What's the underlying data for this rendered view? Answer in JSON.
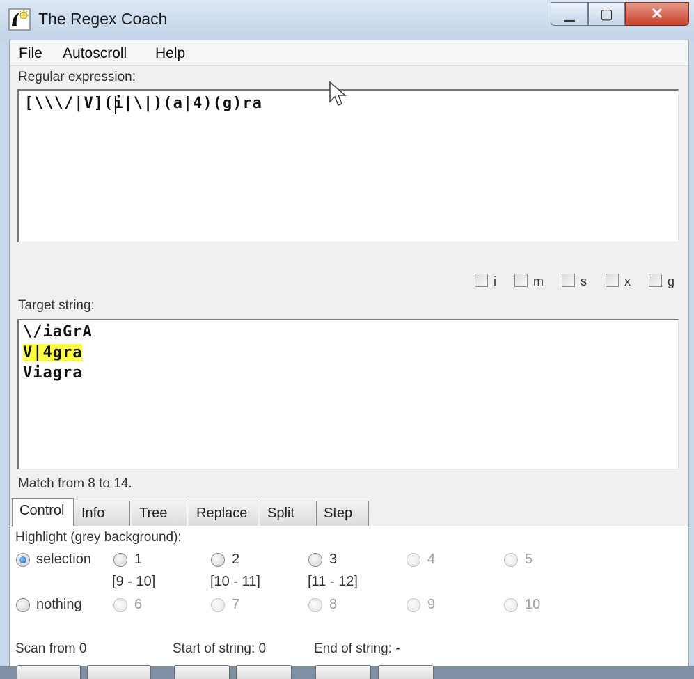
{
  "window": {
    "title": "The Regex Coach"
  },
  "menu": [
    "File",
    "Autoscroll",
    "Help"
  ],
  "regex": {
    "label": "Regular expression:",
    "value": "[\\\\\\/|V](i|\\|)(a|4)(g)ra"
  },
  "flags": [
    "i",
    "m",
    "s",
    "x",
    "g"
  ],
  "target": {
    "label": "Target string:",
    "lines": [
      "\\/iaGrA",
      "V|4gra",
      "Viagra"
    ],
    "highlighted_line": 1
  },
  "status": "Match from 8 to 14.",
  "tabs": [
    "Control",
    "Info",
    "Tree",
    "Replace",
    "Split",
    "Step"
  ],
  "active_tab": "Control",
  "control": {
    "highlight_label": "Highlight (grey background):",
    "row1": [
      {
        "label": "selection",
        "checked": true,
        "enabled": true,
        "range": ""
      },
      {
        "label": "1",
        "checked": false,
        "enabled": true,
        "range": "[9 - 10]"
      },
      {
        "label": "2",
        "checked": false,
        "enabled": true,
        "range": "[10 - 11]"
      },
      {
        "label": "3",
        "checked": false,
        "enabled": true,
        "range": "[11 - 12]"
      },
      {
        "label": "4",
        "checked": false,
        "enabled": false,
        "range": ""
      },
      {
        "label": "5",
        "checked": false,
        "enabled": false,
        "range": ""
      }
    ],
    "row2": [
      {
        "label": "nothing",
        "enabled": true
      },
      {
        "label": "6",
        "enabled": false
      },
      {
        "label": "7",
        "enabled": false
      },
      {
        "label": "8",
        "enabled": false
      },
      {
        "label": "9",
        "enabled": false
      },
      {
        "label": "10",
        "enabled": false
      }
    ],
    "scan_from": "Scan from 0",
    "start_of_string": "Start of string: 0",
    "end_of_string": "End of string: -"
  }
}
